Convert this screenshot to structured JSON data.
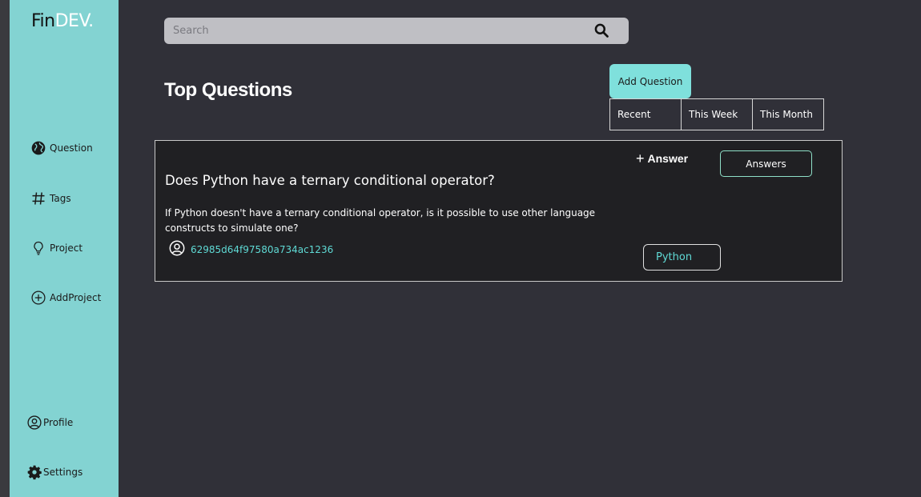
{
  "brand": {
    "fin": "Fin",
    "dev": "DEV."
  },
  "sidebar": {
    "items": [
      {
        "label": "Question",
        "icon": "globe-icon"
      },
      {
        "label": "Tags",
        "icon": "hash-icon"
      },
      {
        "label": "Project",
        "icon": "lightbulb-icon"
      },
      {
        "label": "AddProject",
        "icon": "plus-circle-icon"
      }
    ],
    "bottom": [
      {
        "label": "Profile",
        "icon": "user-circle-icon"
      },
      {
        "label": "Settings",
        "icon": "gear-icon"
      }
    ]
  },
  "search": {
    "placeholder": "Search",
    "value": ""
  },
  "main": {
    "title": "Top Questions",
    "add_question": "Add Question",
    "filters": [
      "Recent",
      "This Week",
      "This Month"
    ]
  },
  "question": {
    "title": "Does Python have a ternary conditional operator?",
    "body": "If Python doesn't have a ternary conditional operator, is it possible to use other language constructs to simulate one?",
    "author_id": "62985d64f97580a734ac1236",
    "answer_label": "Answer",
    "answers_button": "Answers",
    "tag": "Python"
  },
  "colors": {
    "sidebar_bg": "#83d3d2",
    "page_bg": "#303038",
    "card_bg": "#202023",
    "accent": "#7fe0dc",
    "link": "#5fdad5"
  }
}
